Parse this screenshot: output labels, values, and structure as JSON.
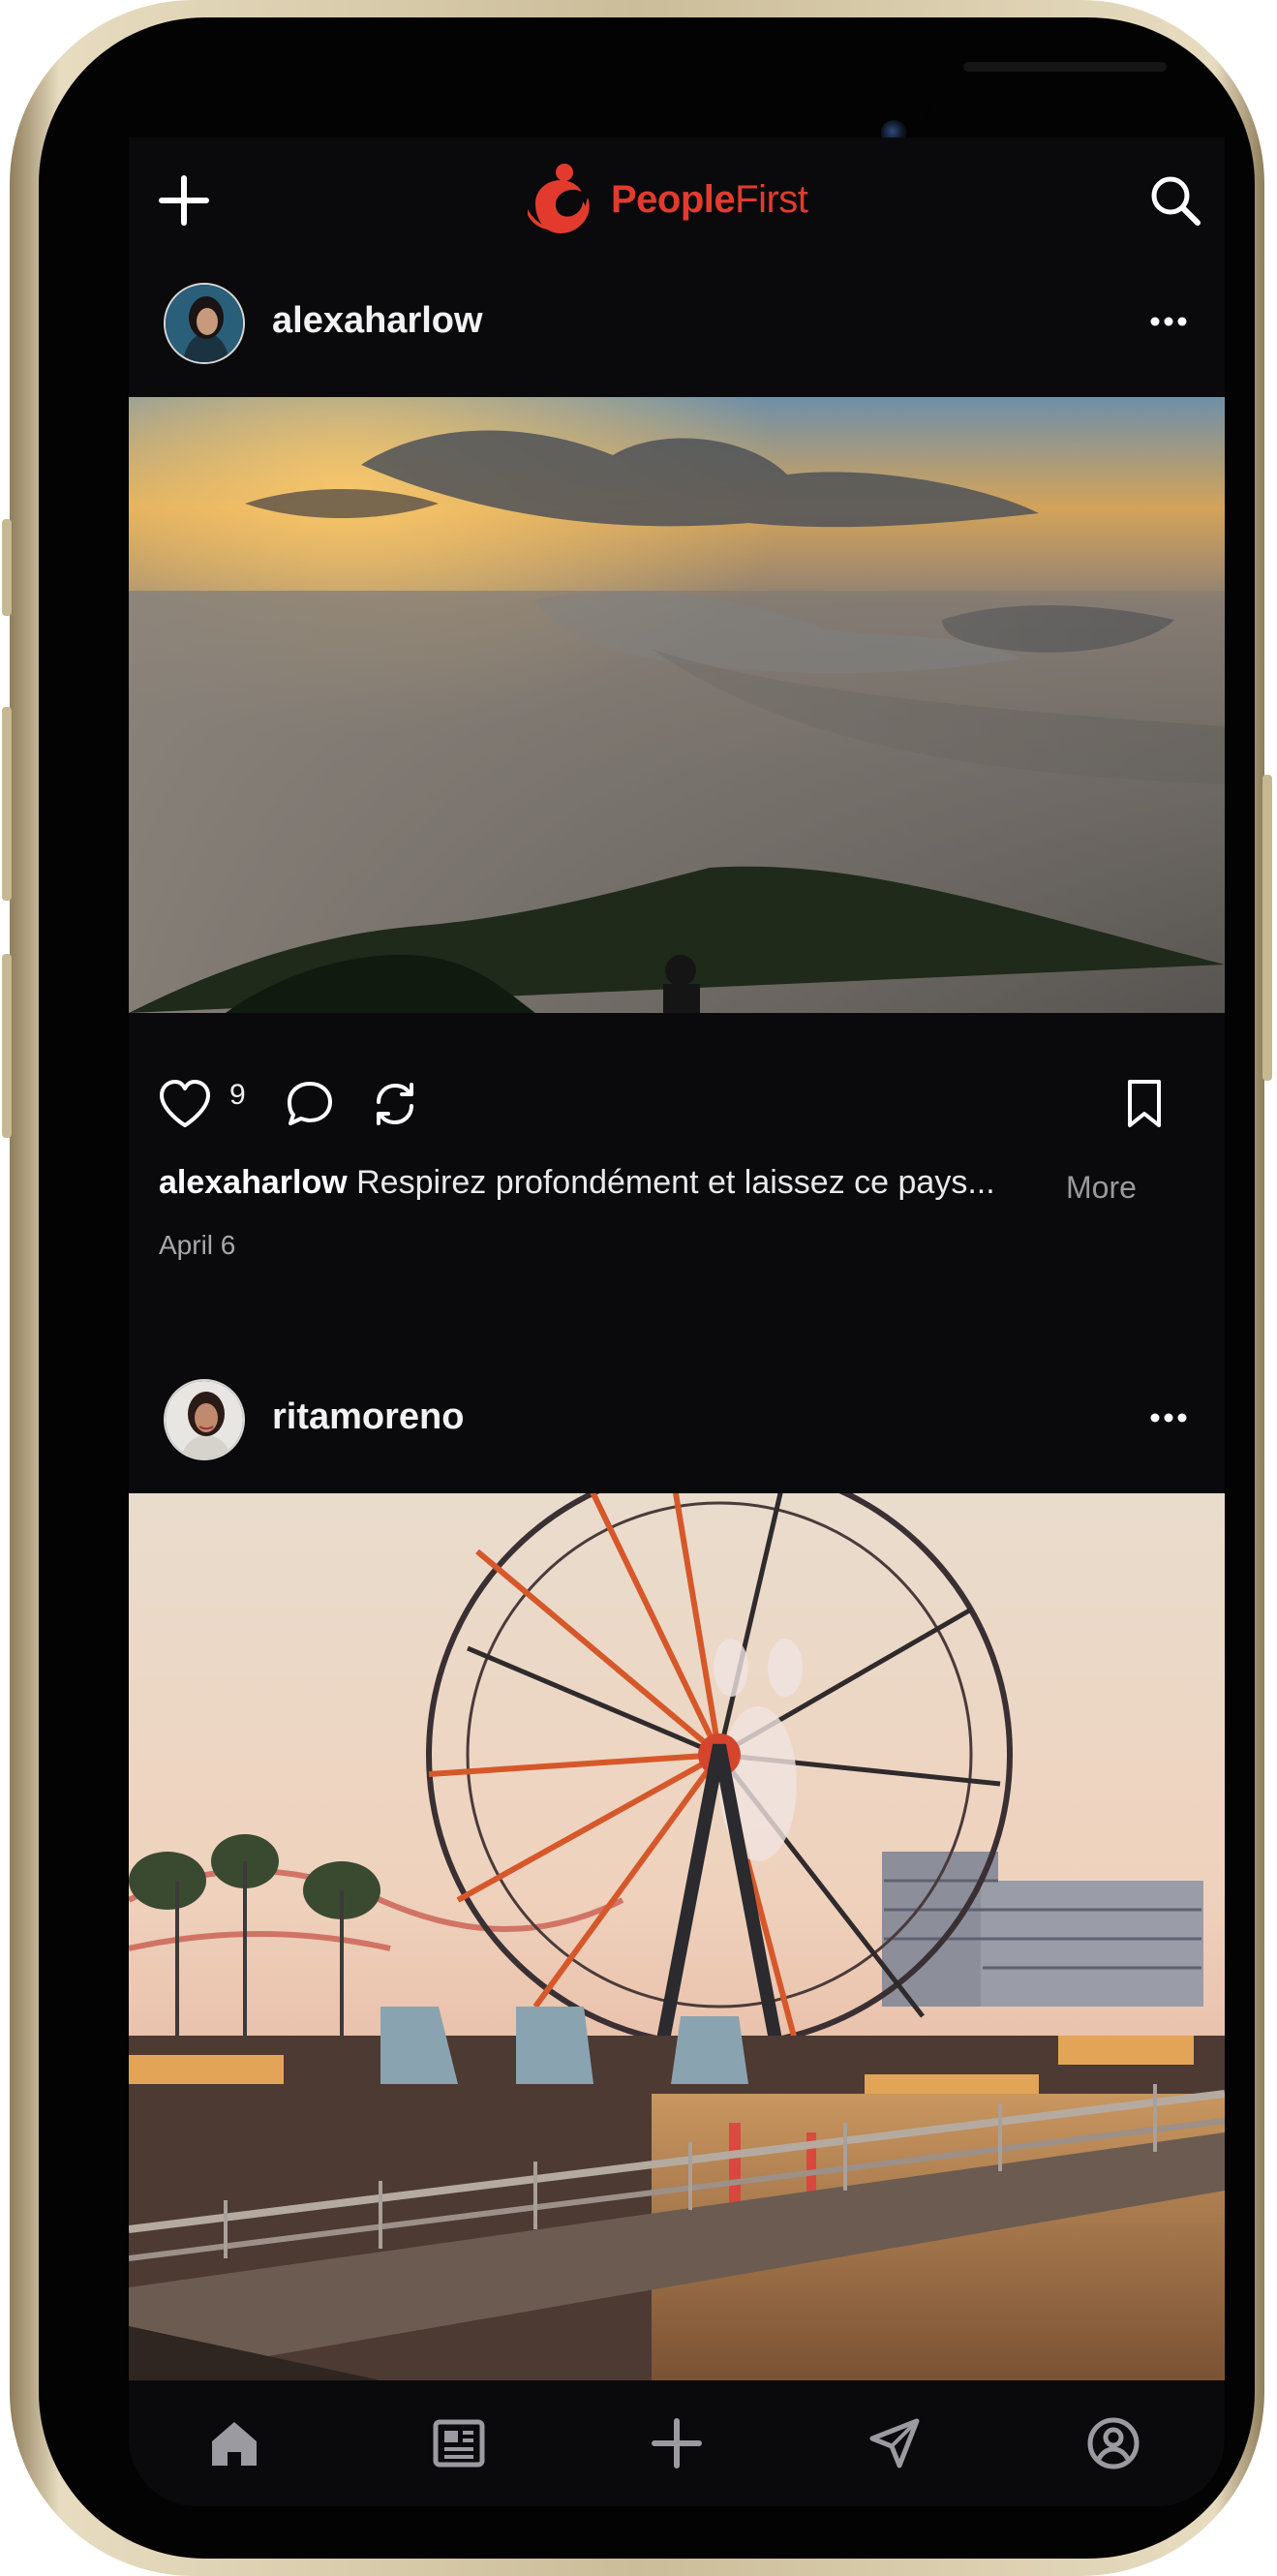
{
  "app": {
    "brand_part1": "People",
    "brand_part2": "First",
    "brand_color": "#e23b2e",
    "top_left_icon": "plus-icon",
    "top_right_icon": "search-icon"
  },
  "posts": [
    {
      "username": "alexaharlow",
      "image": "misty-mountain-sunset-over-city",
      "like_count": "9",
      "caption_user": "alexaharlow",
      "caption_text": "Respirez profondément et laissez ce pays...",
      "more_label": "More",
      "date": "April 6"
    },
    {
      "username": "ritamoreno",
      "image": "ferris-wheel-amusement-park-at-dusk"
    }
  ],
  "bottom_nav": [
    "home-icon",
    "news-icon",
    "add-icon",
    "send-icon",
    "profile-icon"
  ]
}
